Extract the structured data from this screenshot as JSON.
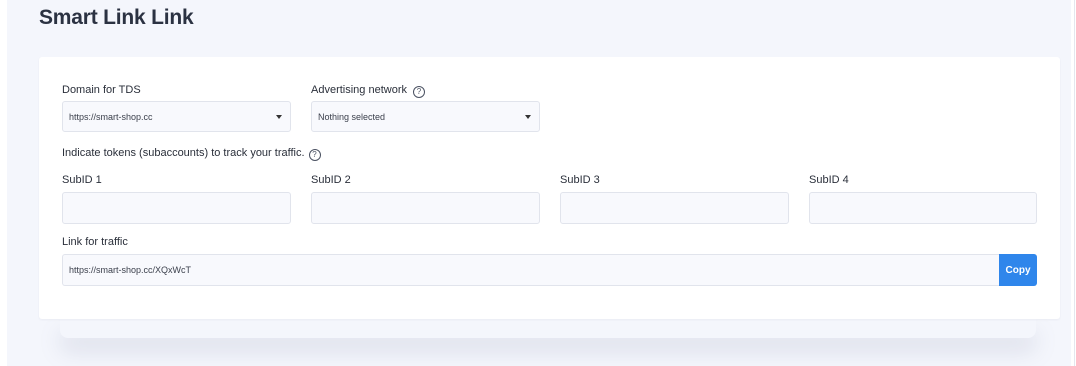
{
  "page": {
    "title": "Smart Link Link"
  },
  "form": {
    "domain": {
      "label": "Domain for TDS",
      "value": "https://smart-shop.cc"
    },
    "network": {
      "label": "Advertising network",
      "value": "Nothing selected",
      "help_icon": "question-circle-icon"
    },
    "tokens_hint": "Indicate tokens (subaccounts) to track your traffic.",
    "subids": [
      {
        "label": "SubID 1",
        "value": ""
      },
      {
        "label": "SubID 2",
        "value": ""
      },
      {
        "label": "SubID 3",
        "value": ""
      },
      {
        "label": "SubID 4",
        "value": ""
      }
    ],
    "link": {
      "label": "Link for traffic",
      "value": "https://smart-shop.cc/XQxWcT"
    },
    "copy_label": "Copy"
  },
  "colors": {
    "accent": "#2f86eb",
    "background": "#f4f6fc",
    "field_bg": "#f8f9fd"
  }
}
